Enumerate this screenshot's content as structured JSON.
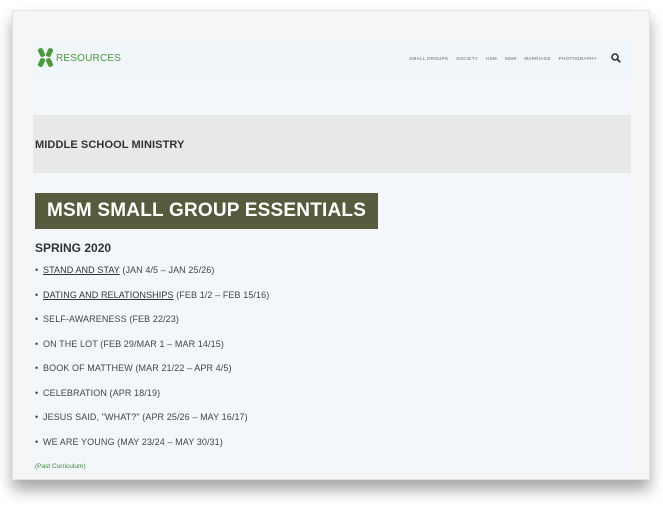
{
  "header": {
    "logo_text": "RESOURCES",
    "nav": [
      "SMALL GROUPS",
      "SOCIETY",
      "HSM",
      "MSM",
      "MARRIAGE",
      "PHOTOGRAPHY"
    ]
  },
  "banner": {
    "title": "MIDDLE SCHOOL MINISTRY"
  },
  "main": {
    "section_title": "MSM SMALL GROUP ESSENTIALS",
    "season": "SPRING 2020",
    "series": [
      {
        "title": "STAND AND STAY",
        "dates": " (JAN 4/5 – JAN 25/26)",
        "link": true
      },
      {
        "title": "DATING AND RELATIONSHIPS",
        "dates": " (FEB 1/2 – FEB 15/16)",
        "link": true
      },
      {
        "title": "SELF-AWARENESS",
        "dates": " (FEB 22/23)",
        "link": false
      },
      {
        "title": "ON THE LOT",
        "dates": " (FEB 29/MAR 1 – MAR 14/15)",
        "link": false
      },
      {
        "title": "BOOK OF MATTHEW",
        "dates": " (MAR 21/22 – APR 4/5)",
        "link": false
      },
      {
        "title": "CELEBRATION",
        "dates": " (APR 18/19)",
        "link": false
      },
      {
        "title": "JESUS SAID, \"WHAT?\"",
        "dates": " (APR 25/26 – MAY 16/17)",
        "link": false
      },
      {
        "title": "WE ARE YOUNG",
        "dates": " (MAY 23/24 – MAY 30/31)",
        "link": false
      }
    ],
    "past_link": "(Past Curriculum)"
  },
  "colors": {
    "brand_green": "#4a9a3a",
    "badge_bg": "#555b3c",
    "banner_bg": "#e7e8e8",
    "page_bg": "#f3f7fc"
  }
}
